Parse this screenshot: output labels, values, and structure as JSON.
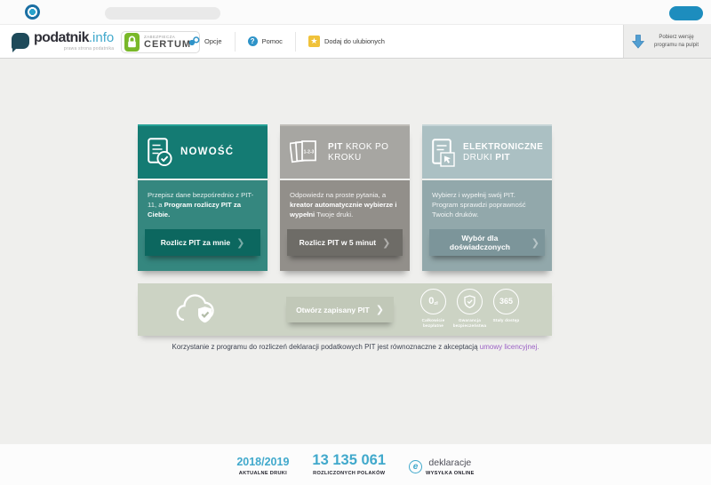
{
  "header": {
    "logo_name": "podatnik",
    "logo_tld": ".info",
    "logo_tagline": "prawa strona podatnika",
    "certum_top": "ZABEZPIECZA",
    "certum_brand": "CERTUM",
    "menu": [
      {
        "label": "Opcje"
      },
      {
        "label": "Pomoc"
      },
      {
        "label": "Dodaj do ulubionych"
      }
    ],
    "download_label": "Pobierz wersję programu na pulpit"
  },
  "cards": [
    {
      "title_b1": "NOWOŚĆ",
      "title_mid": "",
      "title_b2": "",
      "body_1": "Przepisz dane bezpośrednio z PIT-11, a ",
      "body_b": "Program rozliczy PIT za Ciebie.",
      "body_2": "",
      "button_label": "Rozlicz PIT za mnie"
    },
    {
      "title_b1": "PIT",
      "title_mid": " KROK PO KROKU",
      "title_b2": "",
      "body_1": "Odpowiedz na proste pytania, a ",
      "body_b": "kreator automatycznie wybierze i wypełni",
      "body_2": " Twoje druki.",
      "button_label": "Rozlicz PIT w 5 minut"
    },
    {
      "title_b1": "ELEKTRONICZNE",
      "title_mid": " DRUKI ",
      "title_b2": "PIT",
      "body_1": "Wybierz i wypełnij swój PIT. Program sprawdzi poprawność Twoich druków.",
      "body_b": "",
      "body_2": "",
      "button_label": "Wybór dla doświadczonych"
    }
  ],
  "banner": {
    "button_label": "Otwórz zapisany PIT",
    "badges": [
      {
        "value": "0",
        "unit": "zł",
        "label": "Całkowicie bezpłatne"
      },
      {
        "value": "",
        "unit": "",
        "label": "Gwarancja bezpieczeństwa"
      },
      {
        "value": "365",
        "unit": "",
        "label": "Stały dostęp"
      }
    ]
  },
  "license": {
    "text": "Korzystanie z programu do rozliczeń deklaracji podatkowych PIT jest równoznaczne z akceptacją ",
    "link": "umowy licencyjnej."
  },
  "footer": {
    "stats": [
      {
        "value": "2018/2019",
        "label": "AKTUALNE DRUKI"
      },
      {
        "value": "13 135 061",
        "label": "ROZLICZONYCH POLAKÓW"
      }
    ],
    "edeklaracje_name": "deklaracje",
    "edeklaracje_label": "WYSYŁKA ONLINE"
  },
  "palette": {
    "page_bg": "#efefed",
    "teal_head": "#147b73",
    "teal_body": "#35877f",
    "teal_button": "#0c675f",
    "gray_head": "#a7a6a2",
    "gray_body": "#928f8a",
    "gray_button": "#6e6c67",
    "slate_head": "#abc0c3",
    "slate_body": "#92a8ab",
    "slate_button": "#7c959a",
    "banner_bg": "#ccd3c4",
    "banner_button": "#c1c8b8",
    "accent_blue": "#41a9cc",
    "link_purple": "#9a60c4",
    "certum_green": "#79b829",
    "star_yellow": "#f0c23a",
    "window_pill_blue": "#1d8dbe"
  }
}
